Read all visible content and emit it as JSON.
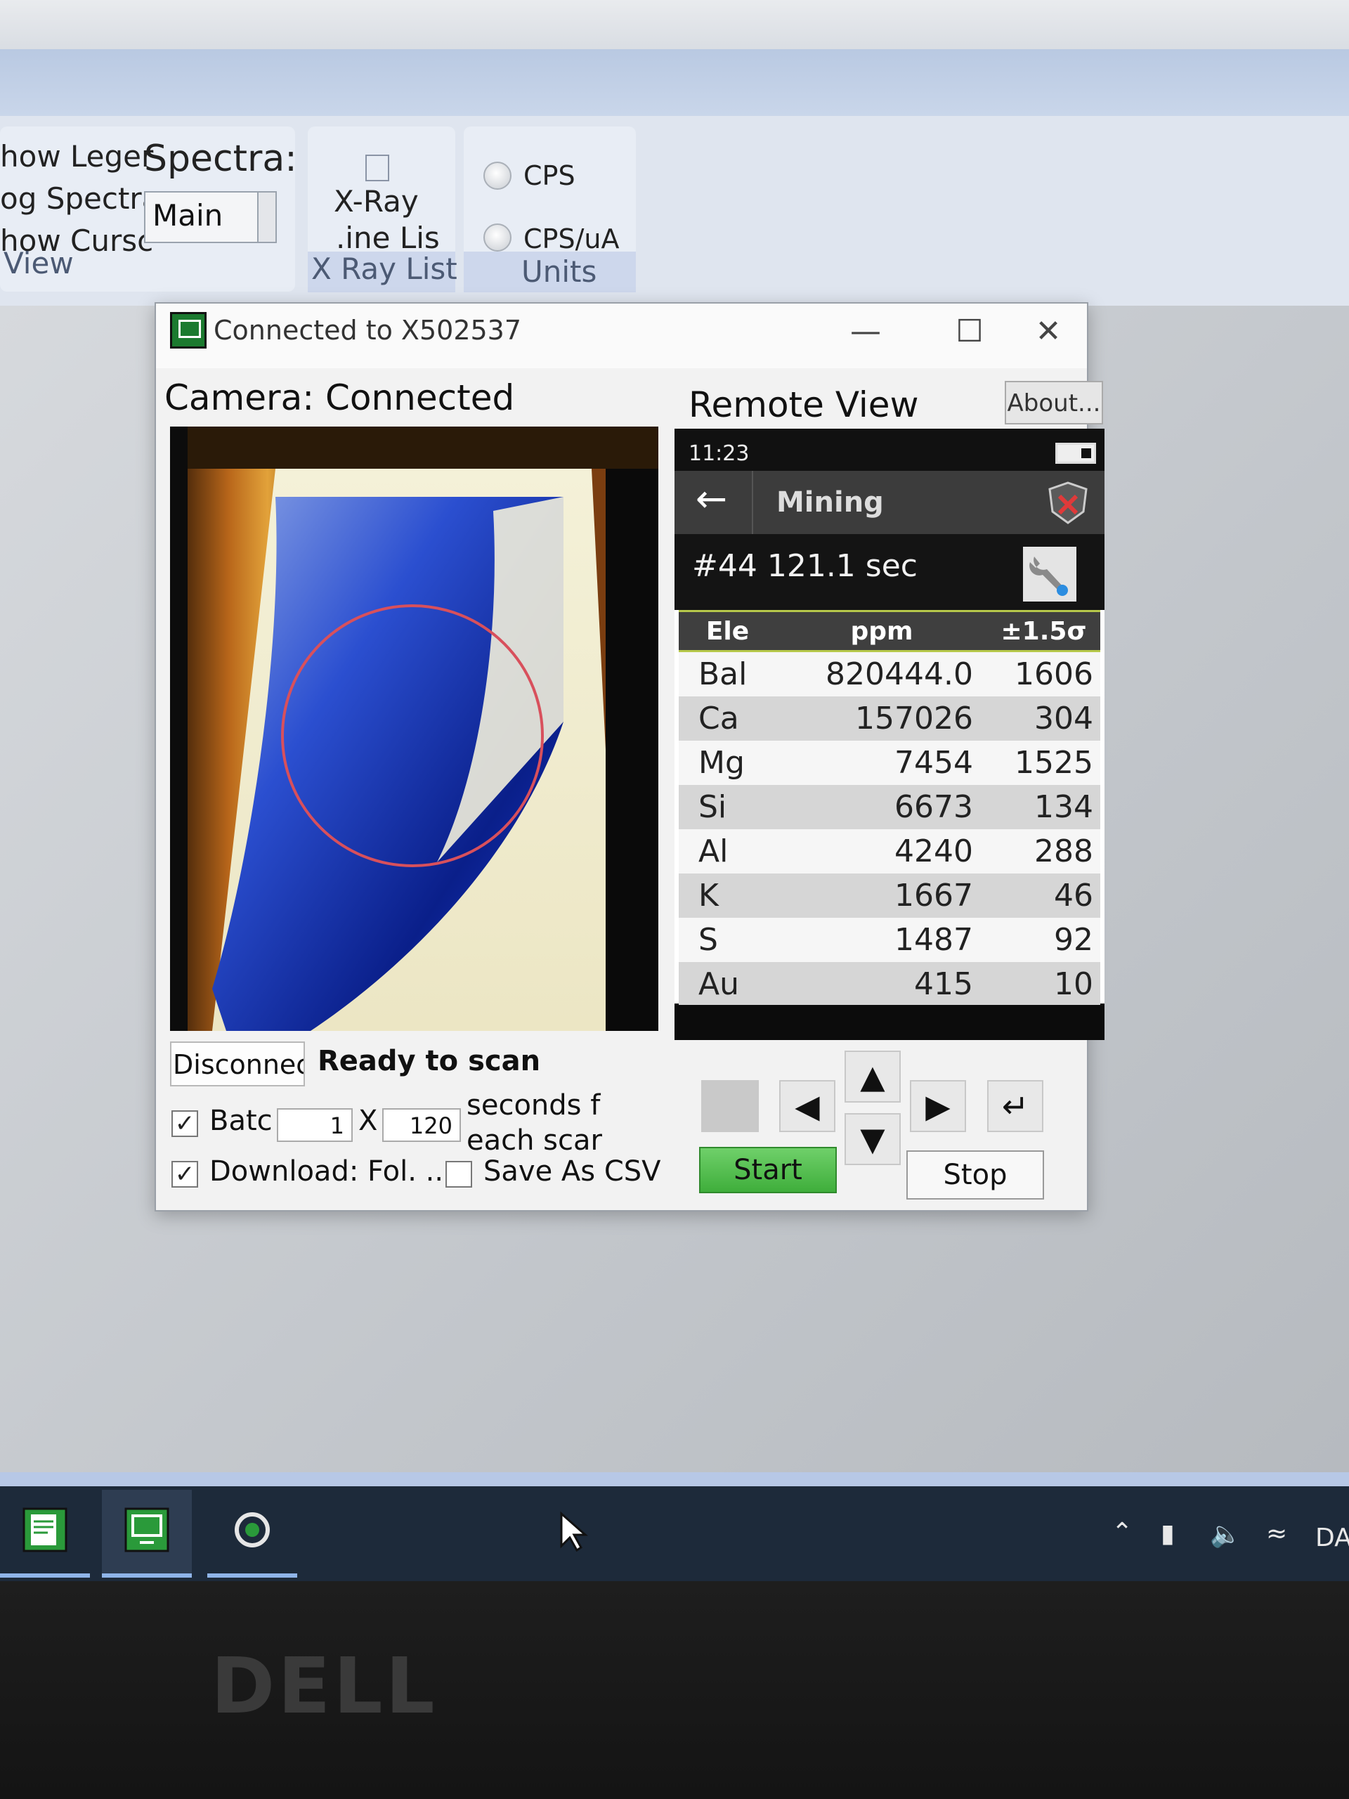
{
  "ribbon": {
    "view_items": [
      "how Leger",
      "og Spectra",
      "how Cursc"
    ],
    "view_group": "View",
    "spectra_label": "Spectra:",
    "spectra_select": "Main",
    "xray_label_1": "X-Ray",
    "xray_label_2": ".ine Lis",
    "xray_group": "X Ray List",
    "units_options": [
      "CPS",
      "CPS/uA"
    ],
    "units_group": "Units"
  },
  "dialog": {
    "title": "Connected to X502537",
    "minimize": "—",
    "maximize": "☐",
    "close": "✕",
    "camera_label": "Camera: Connected",
    "remote_label": "Remote View",
    "about_button": "About..."
  },
  "device": {
    "time": "11:23",
    "app_title": "Mining",
    "scan_info": "#44 121.1 sec",
    "columns": [
      "Ele",
      "ppm",
      "±1.5σ"
    ],
    "rows": [
      {
        "ele": "Bal",
        "ppm": "820444.0",
        "err": "1606"
      },
      {
        "ele": "Ca",
        "ppm": "157026",
        "err": "304"
      },
      {
        "ele": "Mg",
        "ppm": "7454",
        "err": "1525"
      },
      {
        "ele": "Si",
        "ppm": "6673",
        "err": "134"
      },
      {
        "ele": "Al",
        "ppm": "4240",
        "err": "288"
      },
      {
        "ele": "K",
        "ppm": "1667",
        "err": "46"
      },
      {
        "ele": "S",
        "ppm": "1487",
        "err": "92"
      },
      {
        "ele": "Au",
        "ppm": "415",
        "err": "10"
      }
    ]
  },
  "controls": {
    "disconnect_button": "Disconnect",
    "status": "Ready to scan",
    "batch_label": "Batc",
    "batch_count": "1",
    "times_sign": "X",
    "seconds_value": "120",
    "seconds_text_1": "seconds f",
    "seconds_text_2": "each scar",
    "download_label": "Download: Fol. ...",
    "save_csv_label": "Save As CSV",
    "start_button": "Start",
    "stop_button": "Stop",
    "batch_checked": true,
    "download_checked": true,
    "save_csv_checked": false
  },
  "taskbar": {
    "tray_text": "DA"
  },
  "brand": "DELL",
  "colors": {
    "start_green": "#4fbf4a",
    "table_accent": "#b6c84a",
    "camera_circle": "#d8505c"
  }
}
